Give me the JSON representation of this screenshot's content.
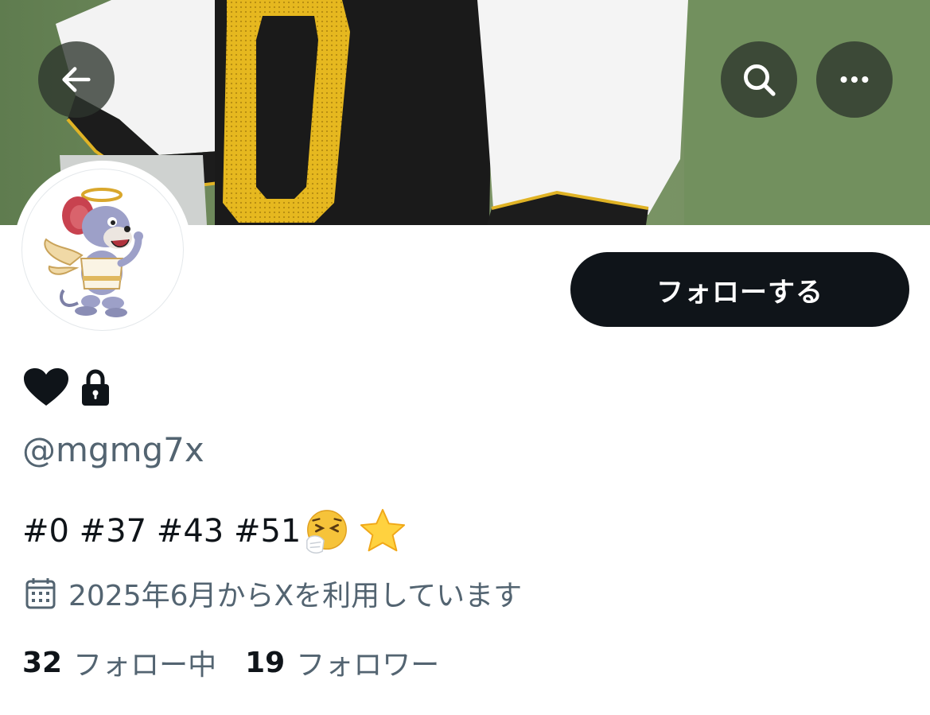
{
  "header": {
    "back_icon": "arrow-left-icon",
    "search_icon": "search-icon",
    "more_icon": "more-horizontal-icon"
  },
  "profile": {
    "display_name_icons": [
      "heart-icon",
      "lock-icon"
    ],
    "handle": "@mgmg7x",
    "bio_text": "#0 #37 #43 #51",
    "bio_emojis": [
      "sneezing-face-emoji",
      "star-emoji"
    ],
    "joined_icon": "calendar-icon",
    "joined": "2025年6月からXを利用しています",
    "follow_label": "フォローする"
  },
  "stats": {
    "following_count": "32",
    "following_label": "フォロー中",
    "followers_count": "19",
    "followers_label": "フォロワー"
  },
  "colors": {
    "primary_text": "#0f1419",
    "secondary_text": "#536471",
    "follow_button_bg": "#0f1419",
    "follow_button_text": "#ffffff"
  }
}
